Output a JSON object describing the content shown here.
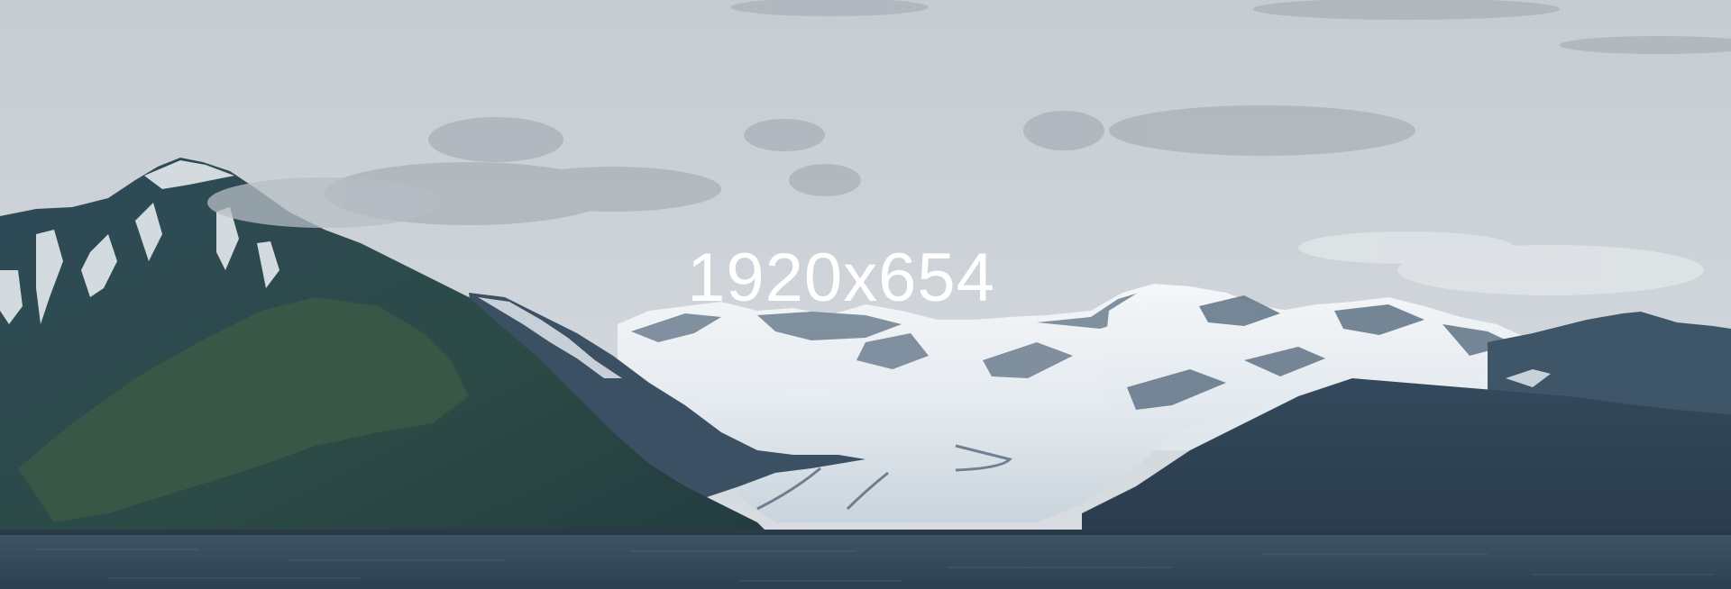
{
  "image": {
    "overlay_text": "1920x654"
  }
}
